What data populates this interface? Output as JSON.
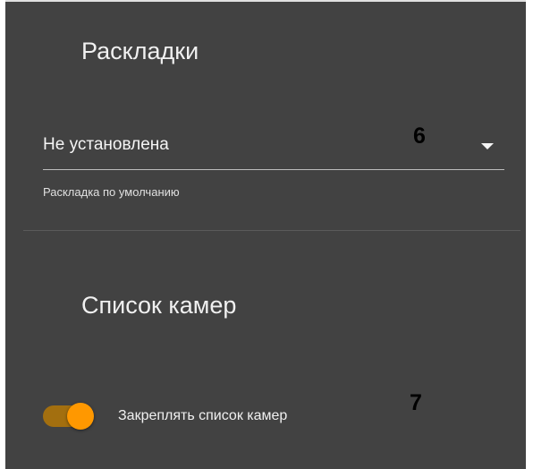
{
  "layouts": {
    "title": "Раскладки",
    "select_value": "Не установлена",
    "helper": "Раскладка по умолчанию",
    "annotation": "6"
  },
  "cameras": {
    "title": "Список камер",
    "toggle_label": "Закреплять список камер",
    "toggle_checked": true,
    "annotation": "7"
  },
  "colors": {
    "panel_bg": "#424242",
    "accent": "#ff9800",
    "track": "#a36f0f",
    "text": "#f0f0f0"
  },
  "icons": {
    "select_arrow": "dropdown-arrow-icon"
  }
}
